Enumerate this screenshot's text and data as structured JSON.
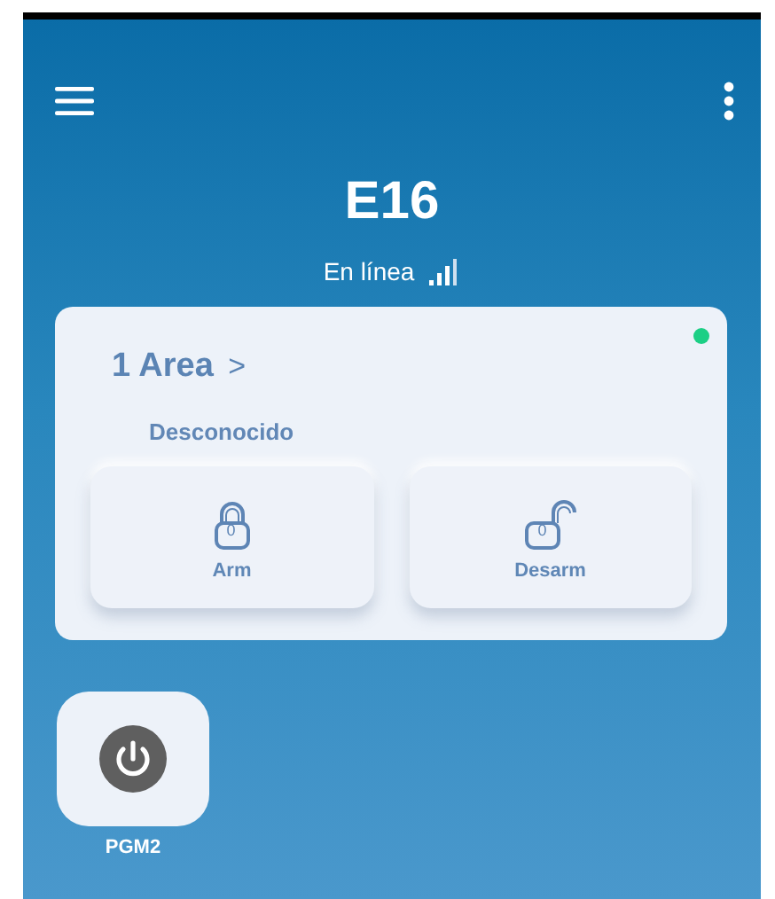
{
  "device": {
    "name": "E16",
    "status": "En línea"
  },
  "area": {
    "title": "1 Area",
    "chevron": ">",
    "state": "Desconocido",
    "online": true
  },
  "actions": [
    {
      "kind": "closed",
      "label": "Arm",
      "digit": "0"
    },
    {
      "kind": "open",
      "label": "Desarm",
      "digit": "0"
    }
  ],
  "outputs": [
    {
      "label": "PGM2"
    }
  ]
}
